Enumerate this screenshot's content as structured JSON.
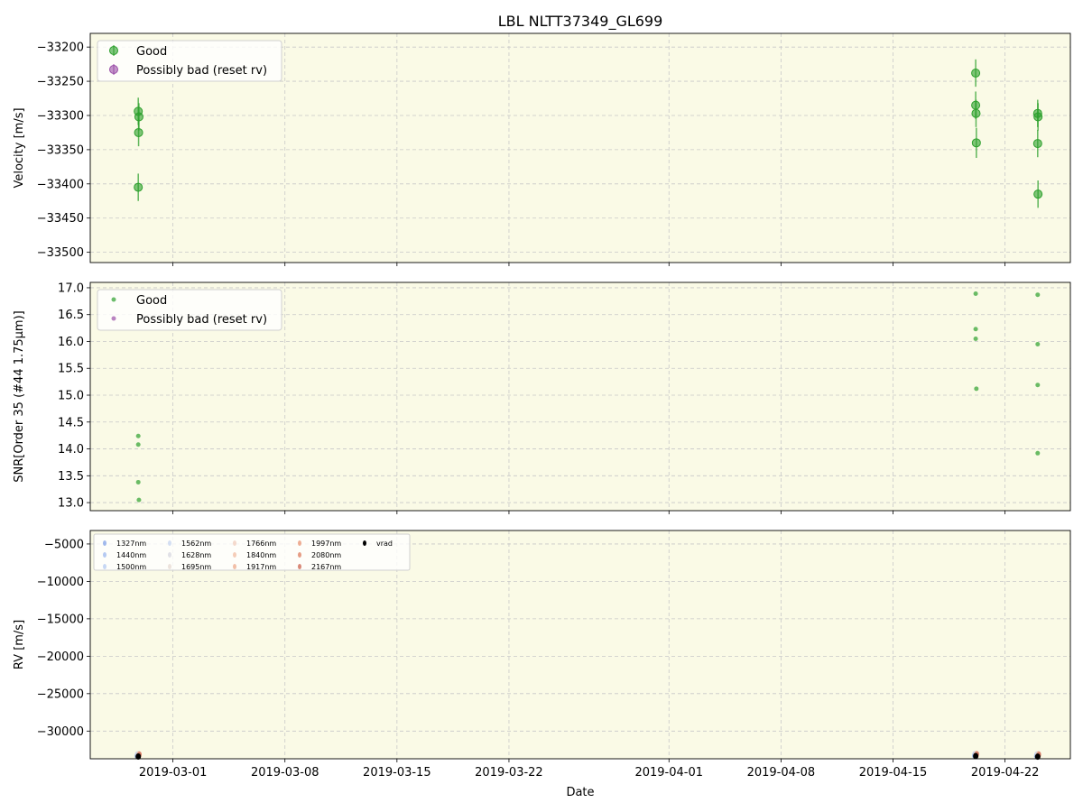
{
  "chart_data": {
    "title": "LBL NLTT37349_GL699",
    "xlabel": "Date",
    "x_range": [
      "2019-02-23T20:00",
      "2019-04-26T02:00"
    ],
    "x_ticks": [
      "2019-03-01",
      "2019-03-08",
      "2019-03-15",
      "2019-03-22",
      "2019-04-01",
      "2019-04-08",
      "2019-04-15",
      "2019-04-22"
    ],
    "background_color": "#fafae6",
    "grid": true,
    "panels": [
      {
        "type": "scatter",
        "ylabel": "Velocity [m/s]",
        "ylim": [
          -33515,
          -33180
        ],
        "yticks": [
          -33200,
          -33250,
          -33300,
          -33350,
          -33400,
          -33450,
          -33500
        ],
        "ytick_labels": [
          "−33200",
          "−33250",
          "−33300",
          "−33350",
          "−33400",
          "−33450",
          "−33500"
        ],
        "error_bars": true,
        "legend_position": "upper-left",
        "series": [
          {
            "name": "Good",
            "color": "#2ca02c",
            "points": [
              {
                "x": "2019-02-26T20:00",
                "y": -33294,
                "err": 20
              },
              {
                "x": "2019-02-26T21:00",
                "y": -33302,
                "err": 20
              },
              {
                "x": "2019-02-26T20:30",
                "y": -33325,
                "err": 20
              },
              {
                "x": "2019-02-26T20:00",
                "y": -33405,
                "err": 20
              },
              {
                "x": "2019-04-20T04:00",
                "y": -33238,
                "err": 20
              },
              {
                "x": "2019-04-20T04:00",
                "y": -33285,
                "err": 20
              },
              {
                "x": "2019-04-20T04:30",
                "y": -33297,
                "err": 20
              },
              {
                "x": "2019-04-20T05:00",
                "y": -33340,
                "err": 22
              },
              {
                "x": "2019-04-24T01:00",
                "y": -33297,
                "err": 20
              },
              {
                "x": "2019-04-24T01:30",
                "y": -33302,
                "err": 20
              },
              {
                "x": "2019-04-24T01:00",
                "y": -33341,
                "err": 20
              },
              {
                "x": "2019-04-24T01:30",
                "y": -33415,
                "err": 20
              }
            ]
          },
          {
            "name": "Possibly bad (reset rv)",
            "color": "#9b4fa8",
            "points": []
          }
        ]
      },
      {
        "type": "scatter",
        "ylabel": "SNR[Order 35 (#44 1.75μm)]",
        "ylim": [
          12.85,
          17.1
        ],
        "yticks": [
          13.0,
          13.5,
          14.0,
          14.5,
          15.0,
          15.5,
          16.0,
          16.5,
          17.0
        ],
        "ytick_labels": [
          "13.0",
          "13.5",
          "14.0",
          "14.5",
          "15.0",
          "15.5",
          "16.0",
          "16.5",
          "17.0"
        ],
        "legend_position": "upper-left",
        "series": [
          {
            "name": "Good",
            "color": "#2ca02c",
            "points": [
              {
                "x": "2019-02-26T20:00",
                "y": 14.24
              },
              {
                "x": "2019-02-26T20:00",
                "y": 14.08
              },
              {
                "x": "2019-02-26T20:00",
                "y": 13.38
              },
              {
                "x": "2019-02-26T21:00",
                "y": 13.05
              },
              {
                "x": "2019-04-20T04:00",
                "y": 16.89
              },
              {
                "x": "2019-04-20T04:00",
                "y": 16.23
              },
              {
                "x": "2019-04-20T04:00",
                "y": 16.05
              },
              {
                "x": "2019-04-20T05:00",
                "y": 15.12
              },
              {
                "x": "2019-04-24T01:00",
                "y": 16.87
              },
              {
                "x": "2019-04-24T01:00",
                "y": 15.95
              },
              {
                "x": "2019-04-24T01:00",
                "y": 15.19
              },
              {
                "x": "2019-04-24T01:00",
                "y": 13.92
              }
            ]
          },
          {
            "name": "Possibly bad (reset rv)",
            "color": "#9b4fa8",
            "points": []
          }
        ]
      },
      {
        "type": "scatter",
        "ylabel": "RV [m/s]",
        "ylim": [
          -33700,
          -3200
        ],
        "yticks": [
          -5000,
          -10000,
          -15000,
          -20000,
          -25000,
          -30000
        ],
        "ytick_labels": [
          "−5000",
          "−10000",
          "−15000",
          "−20000",
          "−25000",
          "−30000"
        ],
        "legend_position": "upper-left",
        "legend_columns": 5,
        "series": [
          {
            "name": "1327nm",
            "color": "#8aa8e8"
          },
          {
            "name": "1440nm",
            "color": "#a3bdf0"
          },
          {
            "name": "1500nm",
            "color": "#b8cdf3"
          },
          {
            "name": "1562nm",
            "color": "#c9d7f1"
          },
          {
            "name": "1628nm",
            "color": "#dad9e2"
          },
          {
            "name": "1695nm",
            "color": "#e8dcd5"
          },
          {
            "name": "1766nm",
            "color": "#f1d0c0"
          },
          {
            "name": "1840nm",
            "color": "#f2c1a8"
          },
          {
            "name": "1917nm",
            "color": "#efaf92"
          },
          {
            "name": "1997nm",
            "color": "#ea9a7c"
          },
          {
            "name": "2080nm",
            "color": "#e08468"
          },
          {
            "name": "2167nm",
            "color": "#d06c58"
          },
          {
            "name": "vrad",
            "color": "#000000"
          }
        ],
        "points": [
          {
            "x": "2019-02-26T20:00",
            "y": -33300
          },
          {
            "x": "2019-02-26T20:00",
            "y": -33400
          },
          {
            "x": "2019-04-20T04:00",
            "y": -33250
          },
          {
            "x": "2019-04-20T04:00",
            "y": -33340
          },
          {
            "x": "2019-04-24T01:00",
            "y": -33300
          },
          {
            "x": "2019-04-24T01:00",
            "y": -33420
          }
        ]
      }
    ]
  }
}
